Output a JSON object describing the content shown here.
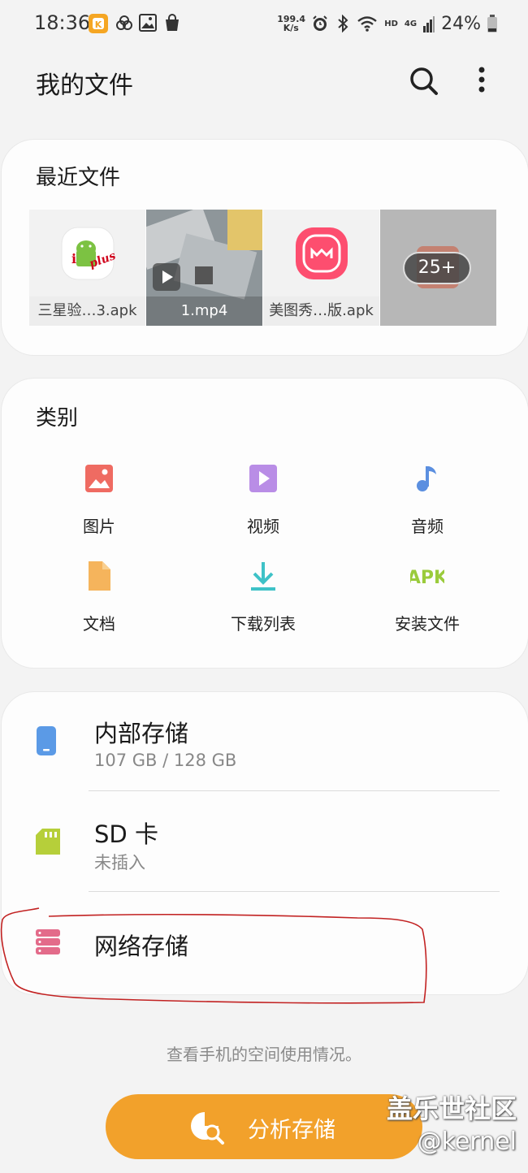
{
  "status_bar": {
    "time": "18:36",
    "net_speed_value": "199.4",
    "net_speed_unit": "K/s",
    "network_badge_hd": "HD",
    "network_badge_4g": "4G",
    "battery": "24%"
  },
  "app_bar": {
    "title": "我的文件",
    "search_icon": "search-icon",
    "more_icon": "more-vertical-icon"
  },
  "recent": {
    "title": "最近文件",
    "files": [
      {
        "name": "三星验…3.apk",
        "kind": "apk"
      },
      {
        "name": "1.mp4",
        "kind": "video"
      },
      {
        "name": "美图秀…版.apk",
        "kind": "apk"
      }
    ],
    "more_count": "25+"
  },
  "categories": {
    "title": "类别",
    "items": [
      {
        "label": "图片",
        "icon": "image-icon",
        "color": "#ef6b62"
      },
      {
        "label": "视频",
        "icon": "video-icon",
        "color": "#b98de6"
      },
      {
        "label": "音频",
        "icon": "music-note-icon",
        "color": "#5b8fe0"
      },
      {
        "label": "文档",
        "icon": "document-icon",
        "color": "#f5b45c"
      },
      {
        "label": "下载列表",
        "icon": "download-icon",
        "color": "#3ec2c7"
      },
      {
        "label": "安装文件",
        "icon": "apk-icon",
        "icon_text": "APK",
        "color": "#9acb3b"
      }
    ]
  },
  "storage": {
    "internal": {
      "name": "内部存储",
      "usage": "107 GB / 128 GB",
      "used_fraction": 0.836,
      "color": "#5b9ae6"
    },
    "sd": {
      "name": "SD 卡",
      "status": "未插入",
      "color": "#b6cf3a"
    },
    "network": {
      "name": "网络存储",
      "color": "#e36b8a"
    }
  },
  "hint": "查看手机的空间使用情况。",
  "analyze_button": {
    "label": "分析存储",
    "color": "#f2a12b"
  },
  "watermark": {
    "brand": "盖乐世社区",
    "user": "@kernel"
  }
}
